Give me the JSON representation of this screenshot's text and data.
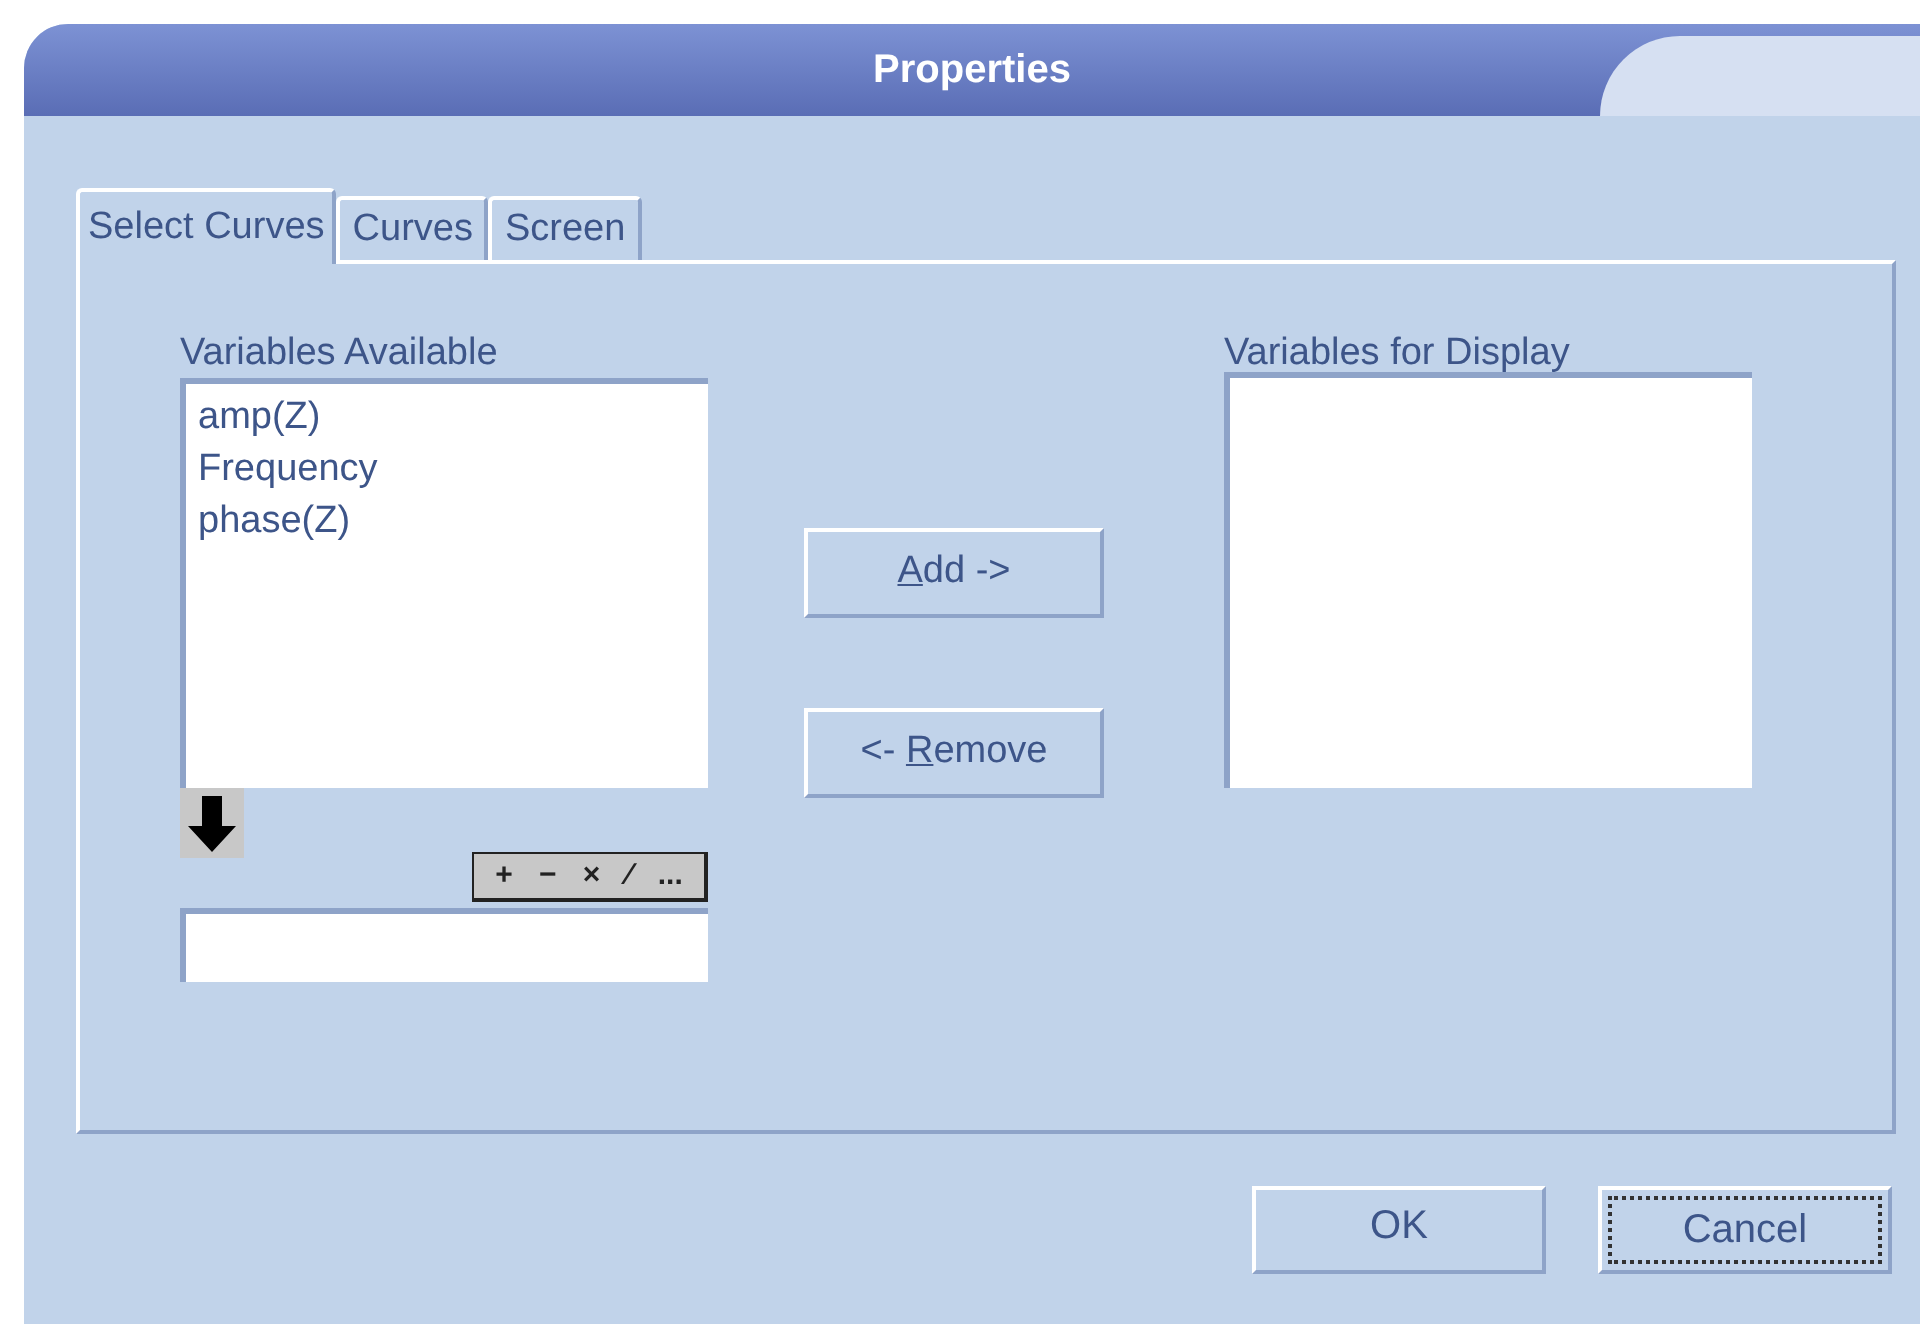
{
  "window": {
    "title": "Properties"
  },
  "tabs": [
    {
      "label": "Select Curves",
      "selected": true
    },
    {
      "label": "Curves",
      "selected": false
    },
    {
      "label": "Screen",
      "selected": false
    }
  ],
  "available": {
    "label": "Variables Available",
    "items": [
      "amp(Z)",
      "Frequency",
      "phase(Z)"
    ]
  },
  "operators": [
    "+",
    "−",
    "×",
    "⁄",
    "..."
  ],
  "move_buttons": [
    {
      "key": "A",
      "after": "dd ->"
    },
    {
      "before": "<- ",
      "key": "R",
      "after": "emove"
    }
  ],
  "display": {
    "label": "Variables for Display"
  },
  "buttons": [
    {
      "label": "OK",
      "focused": false
    },
    {
      "label": "Cancel",
      "focused": true
    }
  ]
}
